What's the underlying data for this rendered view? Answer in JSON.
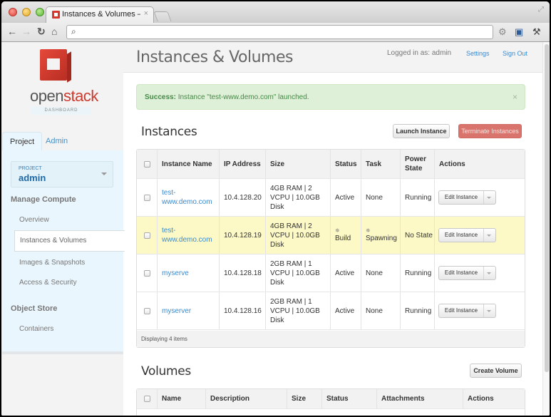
{
  "browser": {
    "tab_title": "Instances & Volumes – OpenStack Dashboard",
    "tab_close": "×",
    "address": "",
    "icons": {
      "back": "←",
      "forward": "→",
      "reload": "↻",
      "home": "⌂",
      "search": "⌕",
      "extension1": "⚙",
      "extension2": "▣",
      "wrench": "⚒",
      "fullscreen": "⤢"
    }
  },
  "brand": {
    "name_part1": "open",
    "name_part2": "stack",
    "subtitle": "DASHBOARD",
    "primary_color": "#cc3a2e"
  },
  "sidebar": {
    "tabs": [
      {
        "label": "Project",
        "active": true
      },
      {
        "label": "Admin",
        "active": false
      }
    ],
    "project_selector": {
      "label": "PROJECT",
      "value": "admin"
    },
    "sections": [
      {
        "heading": "Manage Compute",
        "items": [
          {
            "label": "Overview",
            "active": false
          },
          {
            "label": "Instances & Volumes",
            "active": true
          },
          {
            "label": "Images & Snapshots",
            "active": false
          },
          {
            "label": "Access & Security",
            "active": false
          }
        ]
      },
      {
        "heading": "Object Store",
        "items": [
          {
            "label": "Containers",
            "active": false
          }
        ]
      }
    ]
  },
  "header": {
    "title": "Instances & Volumes",
    "logged_in": "Logged in as: admin",
    "settings": "Settings",
    "sign_out": "Sign Out"
  },
  "alert": {
    "strong": "Success:",
    "message": " Instance \"test-www.demo.com\" launched.",
    "close": "×"
  },
  "instances": {
    "title": "Instances",
    "launch_button": "Launch Instance",
    "terminate_button": "Terminate Instances",
    "columns": [
      "Instance Name",
      "IP Address",
      "Size",
      "Status",
      "Task",
      "Power State",
      "Actions"
    ],
    "rows": [
      {
        "name": "test-www.demo.com",
        "name_l1": "test-",
        "name_l2": "www.demo.com",
        "ip": "10.4.128.20",
        "size": "4GB RAM | 2 VCPU | 10.0GB Disk",
        "status": "Active",
        "task": "None",
        "power": "Running",
        "action": "Edit Instance",
        "highlight": false,
        "busy": false
      },
      {
        "name": "test-www.demo.com",
        "name_l1": "test-",
        "name_l2": "www.demo.com",
        "ip": "10.4.128.19",
        "size": "4GB RAM | 2 VCPU | 10.0GB Disk",
        "status": "Build",
        "task": "Spawning",
        "power": "No State",
        "action": "Edit Instance",
        "highlight": true,
        "busy": true
      },
      {
        "name": "myserve",
        "name_l1": "myserve",
        "name_l2": "",
        "ip": "10.4.128.18",
        "size": "2GB RAM | 1 VCPU | 10.0GB Disk",
        "status": "Active",
        "task": "None",
        "power": "Running",
        "action": "Edit Instance",
        "highlight": false,
        "busy": false
      },
      {
        "name": "myserver",
        "name_l1": "myserver",
        "name_l2": "",
        "ip": "10.4.128.16",
        "size": "2GB RAM | 1 VCPU | 10.0GB Disk",
        "status": "Active",
        "task": "None",
        "power": "Running",
        "action": "Edit Instance",
        "highlight": false,
        "busy": false
      }
    ],
    "footer": "Displaying 4 items"
  },
  "volumes": {
    "title": "Volumes",
    "create_button": "Create Volume",
    "columns": [
      "Name",
      "Description",
      "Size",
      "Status",
      "Attachments",
      "Actions"
    ]
  }
}
